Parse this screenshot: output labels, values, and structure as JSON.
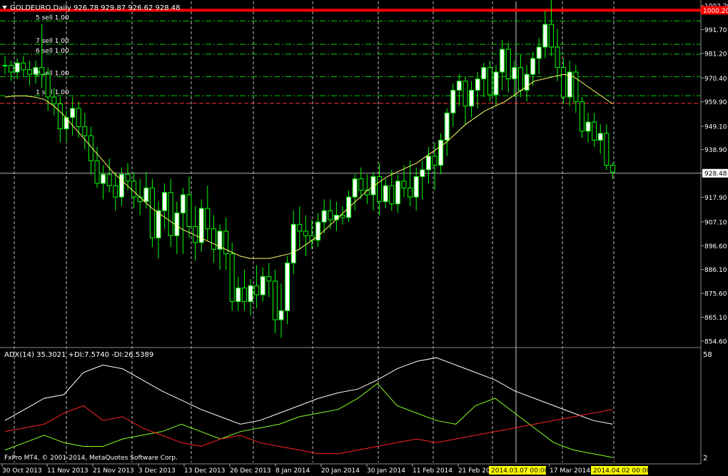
{
  "header": {
    "label": "GOLDEURO,Daily  926.78 929.87 926.62 928.48"
  },
  "indicator": {
    "label": "ADX(14) 35.3021 +DI:7.5740 -DI:26.5389",
    "max_label": "58",
    "min_label": "2"
  },
  "copyright": "FxPro MT4, © 2001-2014, MetaQuotes Software Corp.",
  "price_axis": [
    "1002.20",
    "991.70",
    "981.20",
    "970.40",
    "959.90",
    "949.10",
    "938.90",
    "928.48",
    "917.90",
    "907.10",
    "896.60",
    "886.10",
    "875.60",
    "865.10",
    "854.60"
  ],
  "price_marker_red": "1000.20",
  "current_price": "928.48",
  "time_axis": [
    "30 Oct 2013",
    "11 Nov 2013",
    "21 Nov 2013",
    "3 Dec 2013",
    "13 Dec 2013",
    "26 Dec 2013",
    "8 Jan 2014",
    "20 Jan 2014",
    "30 Jan 2014",
    "11 Feb 2014",
    "21 Feb 20",
    "17 Mar 2014"
  ],
  "time_highlights": [
    "2014.03.07 00:00",
    "2014.04.02 00:00"
  ],
  "sell_levels": [
    {
      "label": "5 sell 1.00",
      "price": 995.5
    },
    {
      "label": "7 sell 1.00",
      "price": 985.2
    },
    {
      "label": "6 sell 1.00",
      "price": 980.9
    },
    {
      "label": "2 sell 1.00",
      "price": 971.0
    },
    {
      "label": "1 sell 1.00",
      "price": 962.6
    }
  ],
  "colors": {
    "bull": "#ffffff",
    "bear": "#000000",
    "wick": "#00ff00",
    "ma": "#ffff66",
    "adx": "#ffffff",
    "plus_di": "#88ff22",
    "minus_di": "#ff2222",
    "level": "#00cc00",
    "red_line": "#ff0000",
    "grid": "#ffffff"
  },
  "chart_data": {
    "type": "candlestick",
    "ylim": [
      854.6,
      1002.2
    ],
    "candles": [
      [
        976,
        980,
        972,
        976
      ],
      [
        976,
        978,
        969,
        973
      ],
      [
        973,
        979,
        970,
        977
      ],
      [
        977,
        980,
        971,
        974
      ],
      [
        974,
        978,
        967,
        972
      ],
      [
        972,
        978,
        968,
        975
      ],
      [
        975,
        994,
        966,
        972
      ],
      [
        972,
        975,
        956,
        962
      ],
      [
        962,
        966,
        954,
        959
      ],
      [
        959,
        962,
        942,
        948
      ],
      [
        948,
        956,
        942,
        953
      ],
      [
        953,
        962,
        945,
        957
      ],
      [
        957,
        960,
        944,
        949
      ],
      [
        949,
        955,
        939,
        945
      ],
      [
        945,
        949,
        928,
        934
      ],
      [
        934,
        940,
        922,
        924
      ],
      [
        924,
        932,
        917,
        928
      ],
      [
        928,
        935,
        920,
        923
      ],
      [
        923,
        929,
        912,
        918
      ],
      [
        918,
        931,
        914,
        928
      ],
      [
        928,
        933,
        921,
        925
      ],
      [
        925,
        929,
        913,
        918
      ],
      [
        918,
        926,
        910,
        916
      ],
      [
        916,
        929,
        913,
        922
      ],
      [
        922,
        926,
        896,
        900
      ],
      [
        900,
        916,
        891,
        912
      ],
      [
        912,
        924,
        904,
        920
      ],
      [
        920,
        926,
        896,
        901
      ],
      [
        901,
        916,
        893,
        911
      ],
      [
        911,
        922,
        893,
        919
      ],
      [
        919,
        927,
        900,
        905
      ],
      [
        905,
        914,
        890,
        898
      ],
      [
        898,
        917,
        894,
        913
      ],
      [
        913,
        923,
        899,
        904
      ],
      [
        904,
        910,
        889,
        895
      ],
      [
        895,
        906,
        886,
        903
      ],
      [
        903,
        909,
        886,
        893
      ],
      [
        893,
        898,
        868,
        872
      ],
      [
        872,
        883,
        868,
        878
      ],
      [
        878,
        886,
        868,
        872
      ],
      [
        872,
        882,
        866,
        879
      ],
      [
        879,
        888,
        869,
        875
      ],
      [
        875,
        887,
        872,
        883
      ],
      [
        883,
        889,
        874,
        881
      ],
      [
        881,
        886,
        858,
        864
      ],
      [
        864,
        880,
        856,
        868
      ],
      [
        868,
        892,
        862,
        889
      ],
      [
        889,
        912,
        884,
        906
      ],
      [
        906,
        914,
        895,
        903
      ],
      [
        903,
        910,
        892,
        901
      ],
      [
        901,
        908,
        895,
        899
      ],
      [
        899,
        911,
        896,
        907
      ],
      [
        907,
        917,
        902,
        912
      ],
      [
        912,
        917,
        904,
        908
      ],
      [
        908,
        916,
        903,
        910
      ],
      [
        910,
        914,
        906,
        909
      ],
      [
        909,
        921,
        907,
        918
      ],
      [
        918,
        928,
        912,
        926
      ],
      [
        926,
        931,
        917,
        921
      ],
      [
        921,
        928,
        915,
        919
      ],
      [
        919,
        929,
        912,
        927
      ],
      [
        927,
        933,
        910,
        916
      ],
      [
        916,
        926,
        913,
        923
      ],
      [
        923,
        930,
        912,
        915
      ],
      [
        915,
        928,
        911,
        925
      ],
      [
        925,
        932,
        918,
        922
      ],
      [
        922,
        934,
        914,
        918
      ],
      [
        918,
        931,
        912,
        927
      ],
      [
        927,
        934,
        917,
        930
      ],
      [
        930,
        940,
        924,
        936
      ],
      [
        936,
        942,
        921,
        932
      ],
      [
        932,
        946,
        928,
        943
      ],
      [
        943,
        957,
        936,
        955
      ],
      [
        955,
        968,
        949,
        965
      ],
      [
        965,
        972,
        958,
        969
      ],
      [
        969,
        971,
        950,
        958
      ],
      [
        958,
        969,
        953,
        965
      ],
      [
        965,
        973,
        957,
        970
      ],
      [
        970,
        977,
        962,
        975
      ],
      [
        975,
        978,
        960,
        963
      ],
      [
        963,
        976,
        958,
        973
      ],
      [
        973,
        987,
        965,
        983
      ],
      [
        983,
        986,
        964,
        970
      ],
      [
        970,
        978,
        962,
        975
      ],
      [
        975,
        981,
        962,
        965
      ],
      [
        965,
        976,
        960,
        972
      ],
      [
        972,
        982,
        967,
        979
      ],
      [
        979,
        988,
        972,
        984
      ],
      [
        984,
        1000,
        979,
        994
      ],
      [
        994,
        1005,
        980,
        984
      ],
      [
        984,
        992,
        969,
        975
      ],
      [
        975,
        979,
        959,
        962
      ],
      [
        962,
        978,
        958,
        973
      ],
      [
        973,
        976,
        955,
        960
      ],
      [
        960,
        962,
        944,
        947
      ],
      [
        947,
        955,
        942,
        951
      ],
      [
        951,
        955,
        940,
        943
      ],
      [
        943,
        950,
        937,
        946
      ],
      [
        946,
        950,
        930,
        932
      ],
      [
        932,
        933,
        926,
        929
      ]
    ],
    "ma": [
      962,
      962.5,
      962.5,
      962,
      961,
      958,
      954,
      949,
      944,
      939,
      934,
      929,
      925,
      921,
      917,
      913,
      910,
      907,
      904,
      902,
      900,
      898,
      896,
      894,
      892,
      891,
      891,
      891,
      892,
      893,
      895,
      898,
      901,
      905,
      909,
      913,
      917,
      921,
      924,
      927,
      929,
      931,
      933,
      936,
      939,
      942,
      946,
      950,
      953,
      956,
      958,
      960,
      963,
      966,
      969,
      970,
      971,
      972,
      971,
      968,
      965,
      962,
      959
    ],
    "adx": [
      22,
      28,
      34,
      36,
      48,
      52,
      50,
      44,
      38,
      33,
      28,
      24,
      20,
      22,
      26,
      30,
      34,
      37,
      39,
      44,
      50,
      54,
      56,
      52,
      48,
      44,
      38,
      34,
      30,
      26,
      22,
      20
    ],
    "plus_di": [
      6,
      10,
      14,
      10,
      8,
      8,
      12,
      14,
      16,
      20,
      16,
      12,
      16,
      18,
      20,
      24,
      26,
      28,
      34,
      42,
      30,
      26,
      22,
      20,
      30,
      34,
      26,
      18,
      10,
      6,
      4,
      2
    ],
    "minus_di": [
      16,
      18,
      20,
      26,
      30,
      22,
      24,
      18,
      14,
      10,
      8,
      12,
      14,
      10,
      8,
      6,
      4,
      4,
      6,
      8,
      10,
      12,
      10,
      12,
      14,
      16,
      18,
      20,
      22,
      24,
      26,
      28
    ]
  }
}
